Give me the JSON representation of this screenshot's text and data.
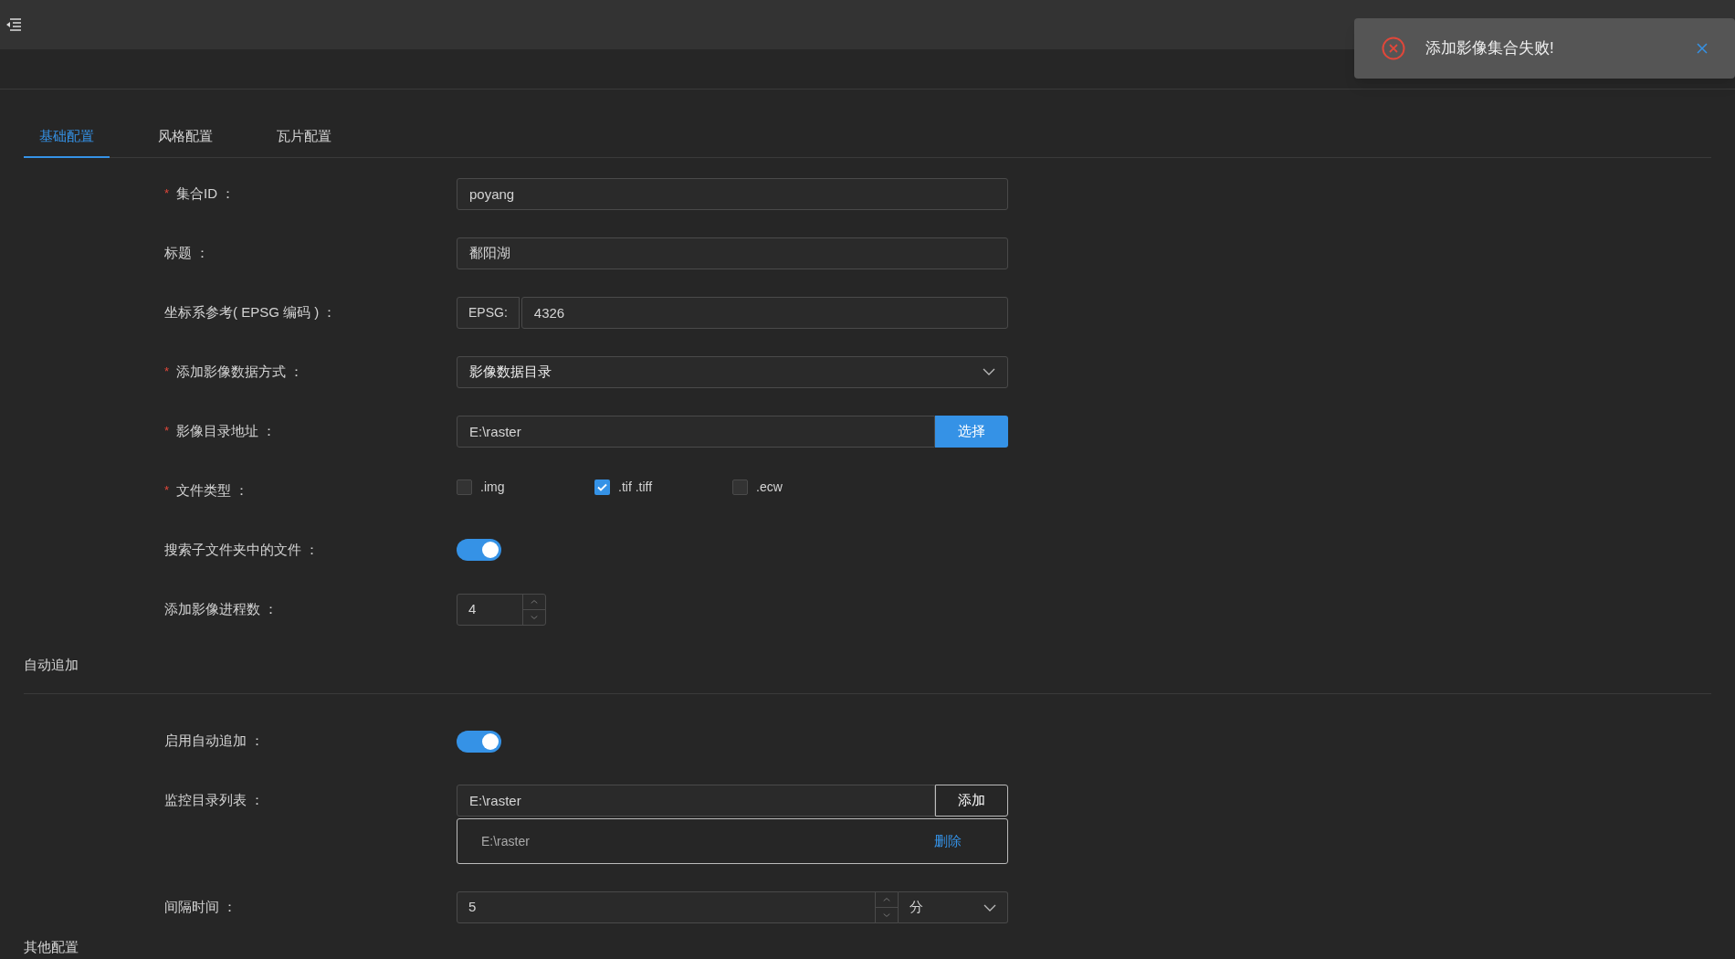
{
  "tabs": [
    {
      "label": "基础配置",
      "selected": true
    },
    {
      "label": "风格配置",
      "selected": false
    },
    {
      "label": "瓦片配置",
      "selected": false
    }
  ],
  "basic_fields": [
    {
      "kind": "text",
      "label": "集合ID ：",
      "required_mark": "*",
      "value": "poyang"
    },
    {
      "kind": "text",
      "label": "标题 ：",
      "value": "鄱阳湖"
    },
    {
      "kind": "addon",
      "label": "坐标系参考( EPSG 编码 ) ：",
      "addon": "EPSG:",
      "value": "4326"
    },
    {
      "kind": "select",
      "label": "添加影像数据方式 ：",
      "required_mark": "*",
      "value": "影像数据目录"
    },
    {
      "kind": "browse",
      "label": "影像目录地址 ：",
      "required_mark": "*",
      "value": "E:\\raster",
      "button": "选择"
    },
    {
      "kind": "checkboxes",
      "label": "文件类型 ：",
      "required_mark": "*",
      "options": [
        {
          "label": ".img",
          "checked": false
        },
        {
          "label": ".tif .tiff",
          "checked": true
        },
        {
          "label": ".ecw",
          "checked": false
        }
      ]
    },
    {
      "kind": "switch",
      "label": "搜索子文件夹中的文件 ：",
      "on": true
    },
    {
      "kind": "number",
      "label": "添加影像进程数 ：",
      "value": "4"
    }
  ],
  "auto_append": {
    "title": "自动追加",
    "fields": [
      {
        "kind": "switch",
        "label": "启用自动追加 ：",
        "on": true
      },
      {
        "kind": "list",
        "label": "监控目录列表 ：",
        "value": "E:\\raster",
        "button": "添加",
        "items": [
          {
            "path": "E:\\raster",
            "action": "删除"
          }
        ]
      },
      {
        "kind": "number_unit",
        "label": "间隔时间 ：",
        "value": "5",
        "unit": "分"
      }
    ]
  },
  "other": {
    "title": "其他配置"
  },
  "toast": {
    "message": "添加影像集合失败!"
  }
}
